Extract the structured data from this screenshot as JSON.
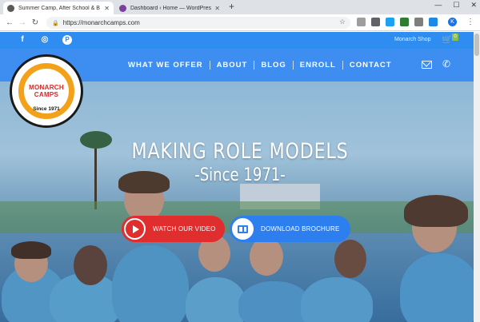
{
  "browser": {
    "tabs": [
      {
        "title": "Summer Camp, After School & B",
        "active": true,
        "favicon_color": "#5a5a5a"
      },
      {
        "title": "Dashboard ‹ Home — WordPress",
        "active": false,
        "favicon_color": "#7b3fa0"
      }
    ],
    "new_tab_label": "+",
    "window_buttons": [
      "—",
      "☐",
      "✕"
    ],
    "url": "https://monarchcamps.com",
    "nav": {
      "back": "←",
      "forward": "→",
      "reload": "↻"
    },
    "profile_initial": "K",
    "star_icon": "☆",
    "menu_icon": "⋮"
  },
  "site": {
    "social": [
      "f",
      "◎",
      "P"
    ],
    "shop_label": "Monarch Shop",
    "cart_count": "0",
    "menu": [
      "WHAT WE OFFER",
      "ABOUT",
      "BLOG",
      "ENROLL",
      "CONTACT"
    ],
    "logo": {
      "name": "MONARCH CAMPS",
      "since": "Since 1971"
    },
    "hero": {
      "headline": "MAKING ROLE MODELS",
      "subline": "-Since 1971-",
      "video_button": "WATCH OUR VIDEO",
      "brochure_button": "DOWNLOAD BROCHURE"
    },
    "colors": {
      "topbar": "#2f8cf0",
      "nav": "#3e8ef2",
      "video": "#e02d2d",
      "brochure": "#2d7ff0"
    }
  }
}
